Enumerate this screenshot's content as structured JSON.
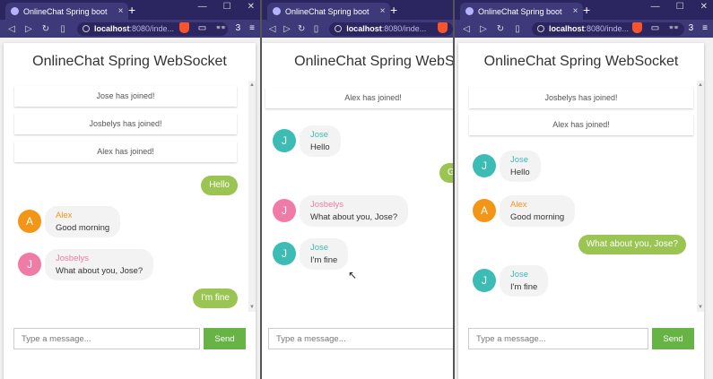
{
  "browser": {
    "tab_title": "OnlineChat Spring boot",
    "tab_close": "×",
    "new_tab": "+",
    "url_host": "localhost",
    "url_path": ":8080/inde...",
    "shield_count": "3"
  },
  "app": {
    "title": "OnlineChat Spring WebSocket",
    "input_placeholder": "Type a message...",
    "send_label": "Send"
  },
  "colors": {
    "jose": "#3cbcb4",
    "alex": "#f39517",
    "josbelys": "#f07ba6",
    "mine_bubble": "#9ac552",
    "send_button": "#67b346"
  },
  "windows": [
    {
      "events": [
        "Jose has joined!",
        "Josbelys has joined!",
        "Alex has joined!"
      ],
      "messages": [
        {
          "mine": true,
          "text": "Hello"
        },
        {
          "mine": false,
          "sender": "Alex",
          "initial": "A",
          "text": "Good morning"
        },
        {
          "mine": false,
          "sender": "Josbelys",
          "initial": "J",
          "text": "What about you, Jose?"
        },
        {
          "mine": true,
          "text": "I'm fine"
        }
      ]
    },
    {
      "events": [
        "Alex has joined!"
      ],
      "messages": [
        {
          "mine": false,
          "sender": "Jose",
          "initial": "J",
          "text": "Hello"
        },
        {
          "mine": true,
          "text": "Good mo"
        },
        {
          "mine": false,
          "sender": "Josbelys",
          "initial": "J",
          "text": "What about you, Jose?"
        },
        {
          "mine": false,
          "sender": "Jose",
          "initial": "J",
          "text": "I'm fine"
        }
      ]
    },
    {
      "events": [
        "Josbelys has joined!",
        "Alex has joined!"
      ],
      "messages": [
        {
          "mine": false,
          "sender": "Jose",
          "initial": "J",
          "text": "Hello"
        },
        {
          "mine": false,
          "sender": "Alex",
          "initial": "A",
          "text": "Good morning"
        },
        {
          "mine": true,
          "text": "What about you, Jose?"
        },
        {
          "mine": false,
          "sender": "Jose",
          "initial": "J",
          "text": "I'm fine"
        }
      ]
    }
  ]
}
